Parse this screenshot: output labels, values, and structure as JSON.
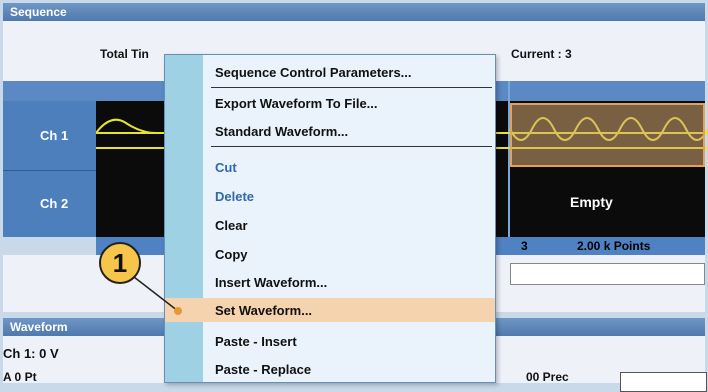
{
  "sequence_panel": {
    "title": "Sequence",
    "total_time_label": "Total Tin",
    "current_label": "Current : 3",
    "channels": [
      {
        "label": "Ch 1"
      },
      {
        "label": "Ch 2",
        "status": "Empty"
      }
    ],
    "selected_segment": {
      "index": "3",
      "points": "2.00 k Points"
    }
  },
  "waveform_panel": {
    "title": "Waveform",
    "ch1_value": "Ch 1: 0 V",
    "partial_left": "A 0 Pt",
    "partial_mid": "00 Prec"
  },
  "context_menu": {
    "items": [
      {
        "label": "Sequence Control Parameters..."
      },
      {
        "label": "Export Waveform To File..."
      },
      {
        "label": "Standard Waveform..."
      },
      {
        "label": "Cut"
      },
      {
        "label": "Delete"
      },
      {
        "label": "Clear"
      },
      {
        "label": "Copy"
      },
      {
        "label": "Insert Waveform..."
      },
      {
        "label": "Set Waveform..."
      },
      {
        "label": "Paste - Insert"
      },
      {
        "label": "Paste - Replace"
      }
    ]
  },
  "callout": {
    "number": "1"
  },
  "colors": {
    "title_bar": "#4f79ad",
    "channel_label": "#4d7fbd",
    "waveform": "#e5e42f",
    "menu_highlight": "#f5d3ae",
    "callout": "#f6c54a"
  }
}
